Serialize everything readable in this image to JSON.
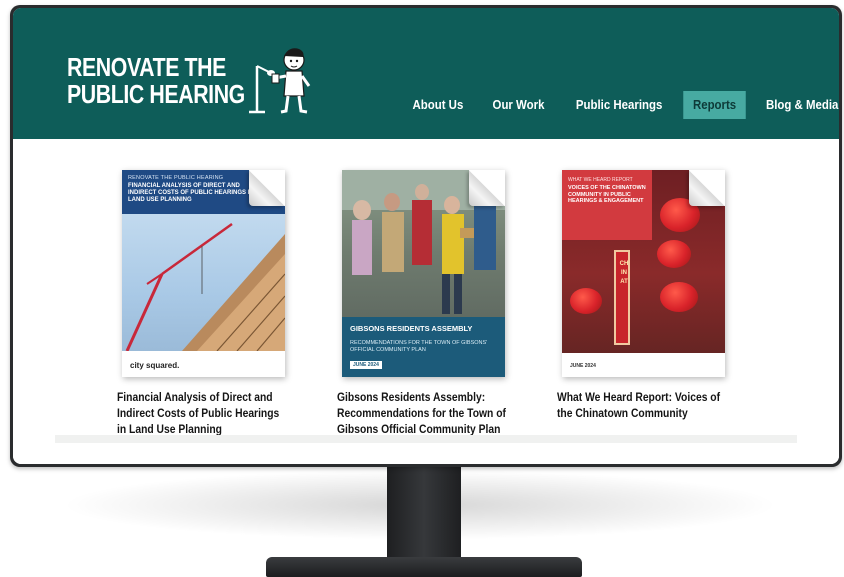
{
  "site": {
    "logo_line1": "RENOVATE THE",
    "logo_line2": "PUBLIC HEARING"
  },
  "nav": {
    "items": [
      {
        "label": "About Us",
        "active": false
      },
      {
        "label": "Our Work",
        "active": false
      },
      {
        "label": "Public Hearings",
        "active": false
      },
      {
        "label": "Reports",
        "active": true
      },
      {
        "label": "Blog & Media",
        "active": false
      }
    ]
  },
  "reports": [
    {
      "title": "Financial Analysis of Direct and Indirect Costs of Public Hearings in Land Use Planning",
      "cover_kicker": "RENOVATE THE PUBLIC HEARING",
      "cover_title": "FINANCIAL ANALYSIS OF DIRECT AND INDIRECT COSTS OF PUBLIC HEARINGS IN LAND USE PLANNING",
      "cover_logo": "city squared."
    },
    {
      "title": "Gibsons Residents Assembly: Recommendations for the Town of Gibsons Official Community Plan",
      "cover_title": "GIBSONS RESIDENTS ASSEMBLY",
      "cover_subtitle": "RECOMMENDATIONS FOR THE TOWN OF GIBSONS' OFFICIAL COMMUNITY PLAN",
      "cover_date": "JUNE 2024"
    },
    {
      "title": "What We Heard Report: Voices of the Chinatown Community",
      "cover_kicker": "WHAT WE HEARD REPORT",
      "cover_title": "VOICES OF THE CHINATOWN COMMUNITY IN PUBLIC HEARINGS & ENGAGEMENT",
      "cover_date": "JUNE 2024",
      "cover_sign": "CHINAT"
    }
  ],
  "colors": {
    "header_bg": "#0e5d59",
    "active_tab": "#47aaa2"
  }
}
